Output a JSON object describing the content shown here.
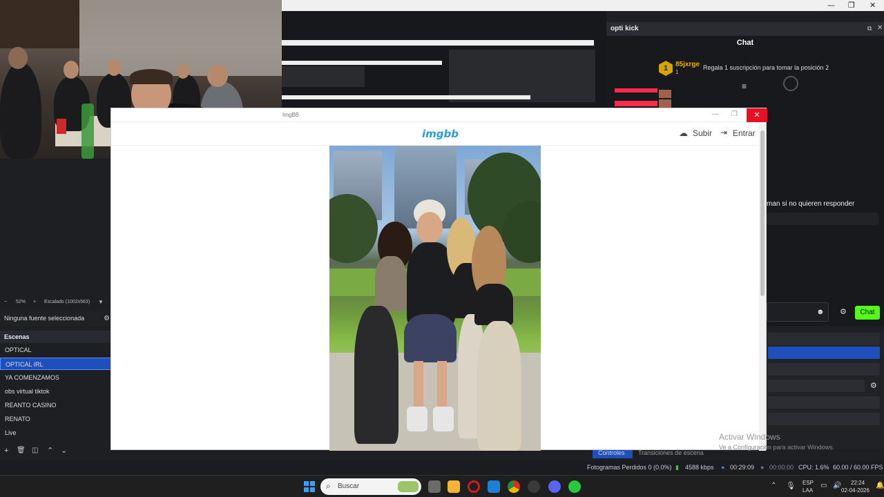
{
  "os_window": {
    "minimize": "—",
    "restore": "❐",
    "close": "✕"
  },
  "chat_panel": {
    "title": "opti kick",
    "heading": "Chat",
    "gift": {
      "badge": "1",
      "username": "85jxrge",
      "count": "1",
      "message": "Regala 1 suscripción para tomar la posición 2"
    },
    "cut_message": "man si no quieren responder",
    "send_button": "Chat"
  },
  "obs": {
    "zoom": "52%",
    "scaling": "Escalado (1002x563)",
    "no_source": "Ninguna fuente seleccionada",
    "scenes_title": "Escenas",
    "scenes": [
      "OPTICAL",
      "OPTICAL IRL",
      "YA COMENZAMOS",
      "obs virtual tiktok",
      "REANTO CASINO",
      "RENATO",
      "Live"
    ],
    "selected_scene": "OPTICAL IRL",
    "tabs": {
      "controls": "Controles",
      "transitions": "Transiciones de escena"
    },
    "status": {
      "dropped": "Fotogramas Perdidos 0 (0.0%)",
      "bitrate": "4588 kbps",
      "live_time": "00:29:09",
      "rec_time": "00:00:00",
      "cpu": "CPU: 1.6%",
      "fps": "60.00 / 60.00 FPS"
    }
  },
  "browser": {
    "title": "ImgBB",
    "logo": "imgbb",
    "upload": "Subir",
    "login": "Entrar"
  },
  "watermark": {
    "line1": "Activar Windows",
    "line2": "Ve a Configuración para activar Windows."
  },
  "taskbar": {
    "search_placeholder": "Buscar",
    "language": "ESP",
    "layout": "LAA",
    "time": "22:24",
    "date": "02-04-2026"
  }
}
